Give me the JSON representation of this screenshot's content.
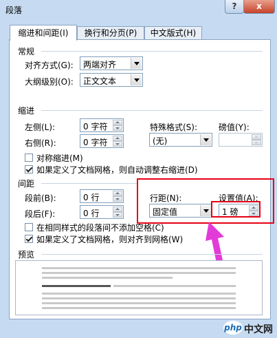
{
  "window": {
    "title": "段落",
    "help_label": "?",
    "close_label": "x"
  },
  "tabs": [
    {
      "label": "缩进和间距(I)",
      "active": true
    },
    {
      "label": "换行和分页(P)",
      "active": false
    },
    {
      "label": "中文版式(H)",
      "active": false
    }
  ],
  "general": {
    "heading": "常规",
    "alignment_label": "对齐方式(G):",
    "alignment_value": "两端对齐",
    "outline_label": "大纲级别(O):",
    "outline_value": "正文文本"
  },
  "indent": {
    "heading": "缩进",
    "left_label": "左侧(L):",
    "left_value": "0 字符",
    "right_label": "右侧(R):",
    "right_value": "0 字符",
    "special_label": "特殊格式(S):",
    "special_value": "(无)",
    "amount_label": "磅值(Y):",
    "amount_value": "",
    "mirror_label": "对称缩进(M)",
    "mirror_checked": false,
    "grid_label": "如果定义了文档网格，则自动调整右缩进(D)",
    "grid_checked": true
  },
  "spacing": {
    "heading": "间距",
    "before_label": "段前(B):",
    "before_value": "0 行",
    "after_label": "段后(F):",
    "after_value": "0 行",
    "line_label": "行距(N):",
    "line_value": "固定值",
    "at_label": "设置值(A):",
    "at_value": "1 磅",
    "same_style_label": "在相同样式的段落间不添加空格(C)",
    "same_style_checked": false,
    "snap_grid_label": "如果定义了文档网格，则对齐到网格(W)",
    "snap_grid_checked": true
  },
  "preview": {
    "heading": "预览"
  },
  "watermark": {
    "badge": "php",
    "text": "中文网"
  },
  "colors": {
    "highlight": "#e60012",
    "arrow": "#e33bd8"
  }
}
